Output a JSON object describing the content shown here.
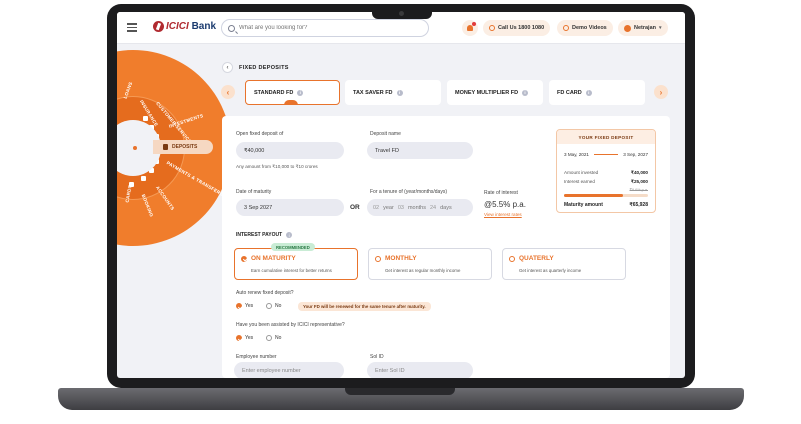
{
  "header": {
    "bank": "ICICI",
    "bank2": "Bank",
    "search_placeholder": "What are you looking for?",
    "call_label": "Call Us 1800 1080",
    "demo_label": "Demo Videos",
    "user_name": "Netrajan"
  },
  "wheel": {
    "active": "DEPOSITS",
    "items": [
      "LOANS",
      "INSURANCE",
      "CUSTOMER SERVICE",
      "INVESTMENTS",
      "PAYMENTS & TRANSFERS",
      "ACCOUNTS",
      "BOOKING",
      "CARDS"
    ]
  },
  "page": {
    "section_title": "FIXED DEPOSITS",
    "tabs": [
      "STANDARD FD",
      "TAX SAVER FD",
      "MONEY MULTIPLIER FD",
      "FD CARD"
    ]
  },
  "form": {
    "open_label": "Open fixed deposit of",
    "amount": "₹40,000",
    "amount_hint": "Any amount from ₹10,000 to ₹10 crores",
    "deposit_name_label": "Deposit name",
    "deposit_name": "Travel FD",
    "maturity_label": "Date of maturity",
    "maturity_date": "3 Sep 2027",
    "or": "OR",
    "tenure_label": "For a tenure of (year/months/days)",
    "tenure_years": "02",
    "tenure_years_unit": "year",
    "tenure_months": "03",
    "tenure_months_unit": "months",
    "tenure_days": "24",
    "tenure_days_unit": "days",
    "rate_label": "Rate of interest",
    "rate": "@5.5% p.a.",
    "rate_link": "View interest rates",
    "payout_label": "INTEREST PAYOUT",
    "payout_options": [
      {
        "title": "ON MATURITY",
        "sub": "Earn cumulative interest for better returns",
        "badge": "RECOMMENDED"
      },
      {
        "title": "MONTHLY",
        "sub": "Get interest as regular monthly income"
      },
      {
        "title": "QUATERLY",
        "sub": "Get interest as quarterly income"
      }
    ],
    "auto_renew_label": "Auto renew fixed deposit?",
    "yes": "Yes",
    "no": "No",
    "renew_note": "Your FD will be renewed for the same tenure after maturity.",
    "assisted_label": "Have you been assisted by ICICI representative?",
    "employee_label": "Employee number",
    "employee_placeholder": "Enter employee number",
    "sol_label": "Sol ID",
    "sol_placeholder": "Enter Sol ID"
  },
  "summary": {
    "title": "YOUR FIXED DEPOSIT",
    "start_date": "3 May, 2021",
    "end_date": "3 Sep, 2027",
    "invested_label": "Amount invested",
    "invested": "₹40,000",
    "earned_label": "Interest earned",
    "earned": "₹25,000",
    "earned_old": "₹9.6% p.a.",
    "maturity_label": "Maturity amount",
    "maturity": "₹65,928",
    "progress": 0.7
  },
  "colors": {
    "accent": "#e8732c",
    "brand": "#b02a30"
  }
}
